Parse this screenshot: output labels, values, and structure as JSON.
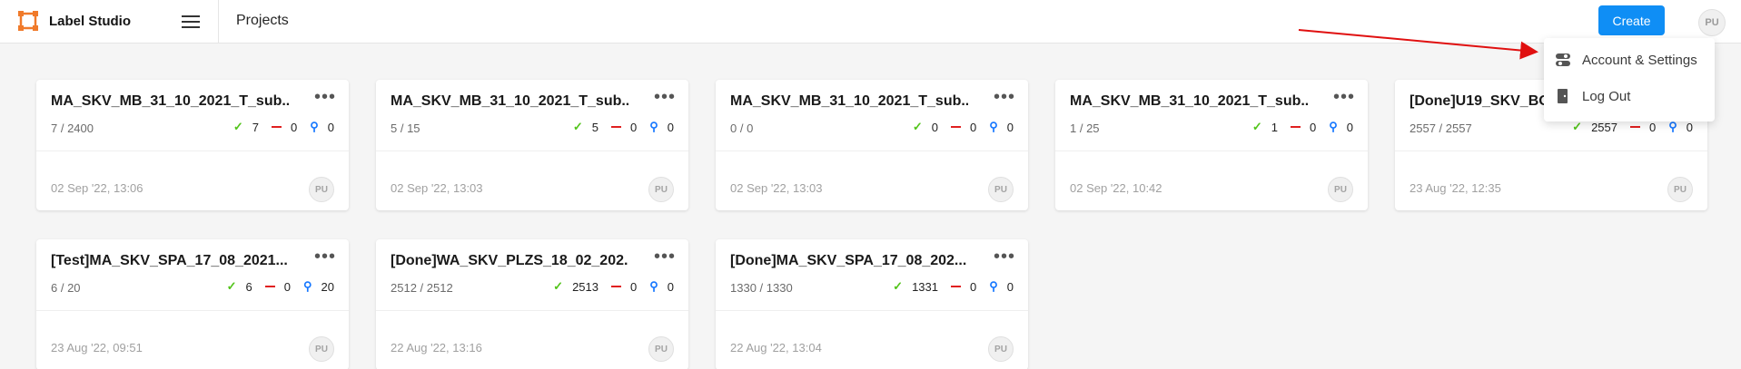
{
  "app": {
    "name": "Label Studio",
    "page_title": "Projects"
  },
  "header": {
    "create_label": "Create",
    "user_initials": "PU",
    "accent_color": "#0f8ef5"
  },
  "user_menu": {
    "items": [
      {
        "label": "Account & Settings",
        "icon": "settings-toggle-icon"
      },
      {
        "label": "Log Out",
        "icon": "door-icon"
      }
    ]
  },
  "projects": [
    {
      "title": "MA_SKV_MB_31_10_2021_T_sub...",
      "progress": "7 / 2400",
      "completed": "7",
      "skipped": "0",
      "predictions": "0",
      "date": "02 Sep '22, 13:06",
      "owner": "PU"
    },
    {
      "title": "MA_SKV_MB_31_10_2021_T_sub...",
      "progress": "5 / 15",
      "completed": "5",
      "skipped": "0",
      "predictions": "0",
      "date": "02 Sep '22, 13:03",
      "owner": "PU"
    },
    {
      "title": "MA_SKV_MB_31_10_2021_T_sub...",
      "progress": "0 / 0",
      "completed": "0",
      "skipped": "0",
      "predictions": "0",
      "date": "02 Sep '22, 13:03",
      "owner": "PU"
    },
    {
      "title": "MA_SKV_MB_31_10_2021_T_sub...",
      "progress": "1 / 25",
      "completed": "1",
      "skipped": "0",
      "predictions": "0",
      "date": "02 Sep '22, 10:42",
      "owner": "PU"
    },
    {
      "title": "[Done]U19_SKV_BOH",
      "progress": "2557 / 2557",
      "completed": "2557",
      "skipped": "0",
      "predictions": "0",
      "date": "23 Aug '22, 12:35",
      "owner": "PU"
    },
    {
      "title": "[Test]MA_SKV_SPA_17_08_2021...",
      "progress": "6 / 20",
      "completed": "6",
      "skipped": "0",
      "predictions": "20",
      "date": "23 Aug '22, 09:51",
      "owner": "PU"
    },
    {
      "title": "[Done]WA_SKV_PLZS_18_02_202...",
      "progress": "2512 / 2512",
      "completed": "2513",
      "skipped": "0",
      "predictions": "0",
      "date": "22 Aug '22, 13:16",
      "owner": "PU"
    },
    {
      "title": "[Done]MA_SKV_SPA_17_08_202...",
      "progress": "1330 / 1330",
      "completed": "1331",
      "skipped": "0",
      "predictions": "0",
      "date": "22 Aug '22, 13:04",
      "owner": "PU"
    }
  ],
  "colors": {
    "completed": "#52c41a",
    "skipped": "#e02020",
    "predictions": "#1677ff",
    "annotation_arrow": "#e01010"
  }
}
